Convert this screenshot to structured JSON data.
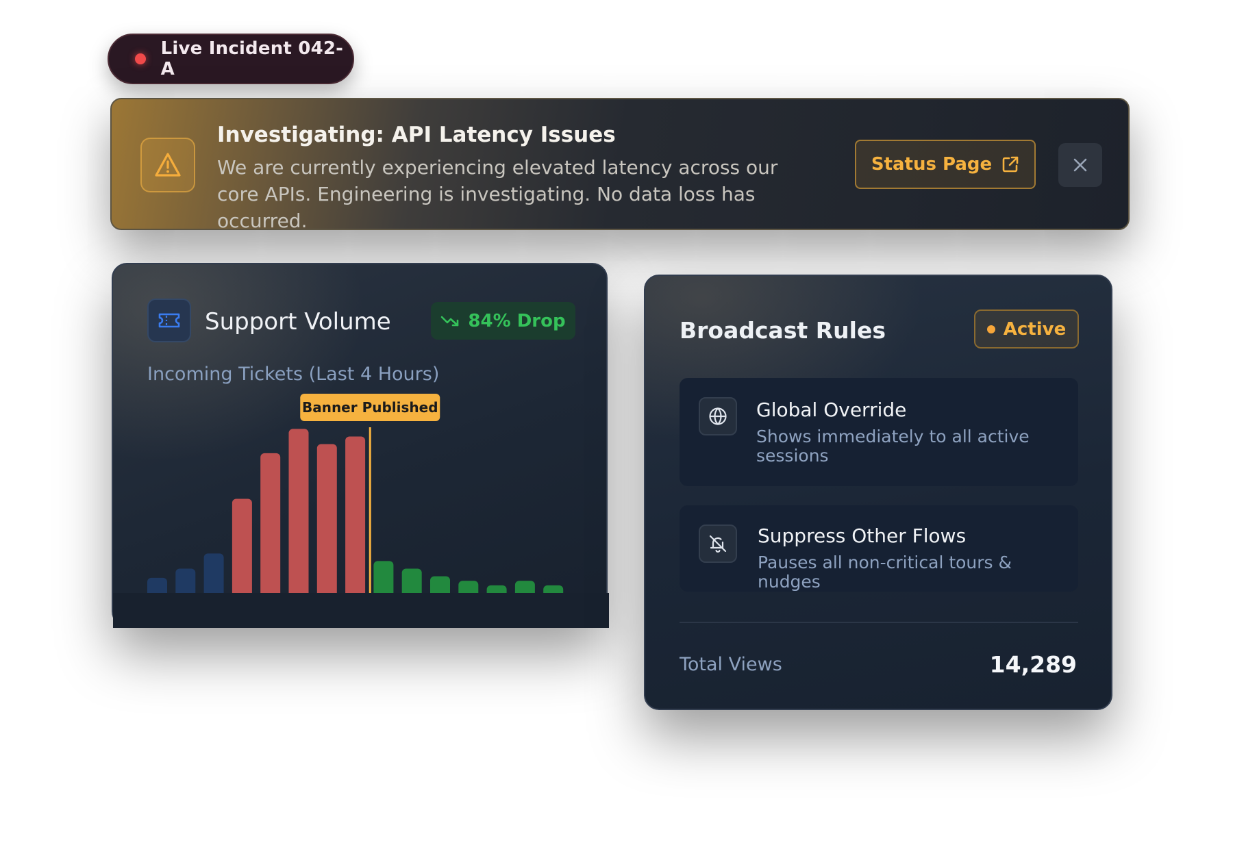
{
  "incident_pill": {
    "label": "Live Incident 042-A"
  },
  "banner": {
    "title": "Investigating: API Latency Issues",
    "description": "We are currently experiencing elevated latency across our core APIs. Engineering is investigating. No data loss has occurred.",
    "status_button_label": "Status Page",
    "icons": {
      "alert": "warning-triangle-icon",
      "status": "external-link-icon",
      "close": "close-icon"
    }
  },
  "support_volume": {
    "title": "Support Volume",
    "badge": "84% Drop",
    "subtitle": "Incoming Tickets (Last 4 Hours)",
    "marker_label": "Banner Published",
    "colors": {
      "before": "#1f3a63",
      "spike": "#be5151",
      "after": "#22893e",
      "marker": "#f6b23f"
    },
    "icons": {
      "card": "ticket-icon",
      "badge": "trend-down-icon"
    }
  },
  "chart_data": {
    "type": "bar",
    "categories": [],
    "values": [
      10,
      16,
      26,
      62,
      92,
      108,
      98,
      103,
      21,
      16,
      11,
      8,
      5,
      8,
      5
    ],
    "colors": [
      "before",
      "before",
      "before",
      "spike",
      "spike",
      "spike",
      "spike",
      "spike",
      "after",
      "after",
      "after",
      "after",
      "after",
      "after",
      "after"
    ],
    "annotation": {
      "label": "Banner Published",
      "after_index": 7
    },
    "title": "Incoming Tickets (Last 4 Hours)",
    "xlabel": "",
    "ylabel": "",
    "ylim": [
      0,
      110
    ],
    "grid": false
  },
  "broadcast_rules": {
    "title": "Broadcast Rules",
    "status": "Active",
    "rules": [
      {
        "title": "Global Override",
        "description": "Shows immediately to all active sessions",
        "icon": "globe-icon"
      },
      {
        "title": "Suppress Other Flows",
        "description": "Pauses all non-critical tours & nudges",
        "icon": "bell-off-icon"
      }
    ],
    "total_views_label": "Total Views",
    "total_views_value": "14,289"
  }
}
